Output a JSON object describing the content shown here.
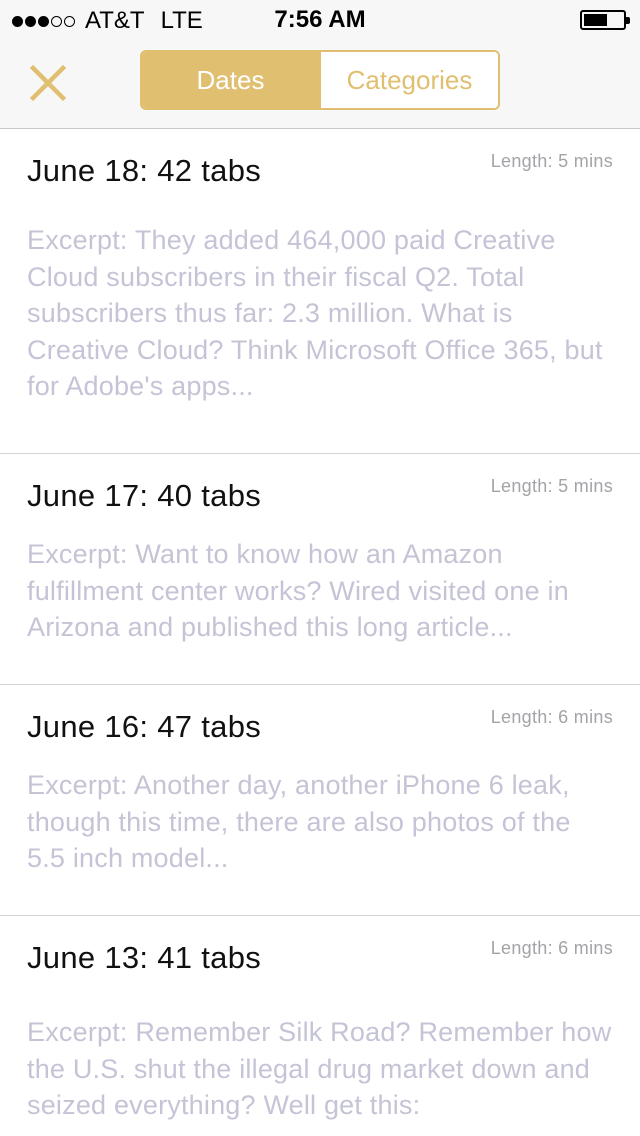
{
  "status": {
    "carrier": "AT&T",
    "network": "LTE",
    "time": "7:56 AM",
    "signal_filled": 3,
    "signal_total": 5,
    "battery_level": 0.6
  },
  "nav": {
    "close_icon": "close-x-icon",
    "segments": [
      {
        "label": "Dates",
        "active": true
      },
      {
        "label": "Categories",
        "active": false
      }
    ],
    "accent_color": "#e0bf70"
  },
  "entries": [
    {
      "title": "June 18: 42 tabs",
      "length": "Length: 5 mins",
      "excerpt": "Excerpt: They added 464,000 paid Creative Cloud subscribers in their fiscal Q2. Total subscribers thus far: 2.3 million. What is Creative Cloud? Think Microsoft Office 365, but for Adobe's apps..."
    },
    {
      "title": "June 17: 40 tabs",
      "length": "Length: 5 mins",
      "excerpt": "Excerpt: Want to know how an Amazon fulfillment center works? Wired visited one in Arizona and published this long article..."
    },
    {
      "title": "June 16: 47 tabs",
      "length": "Length: 6 mins",
      "excerpt": "Excerpt: Another day, another iPhone 6 leak, though this time, there are also photos of the 5.5 inch model..."
    },
    {
      "title": "June 13: 41 tabs",
      "length": "Length: 6 mins",
      "excerpt": "Excerpt: Remember Silk Road? Remember how the U.S. shut the illegal drug market down and seized everything? Well get this:"
    }
  ]
}
